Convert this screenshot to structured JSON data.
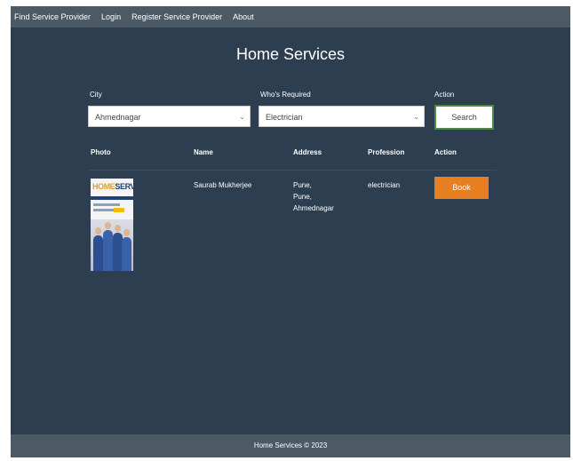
{
  "navbar": {
    "links": [
      "Find Service Provider",
      "Login",
      "Register Service Provider",
      "About"
    ]
  },
  "page": {
    "title": "Home Services"
  },
  "search": {
    "city_label": "City",
    "city_value": "Ahmednagar",
    "who_label": "Who's Required",
    "who_value": "Electrician",
    "action_label": "Action",
    "search_button": "Search"
  },
  "table": {
    "headers": [
      "Photo",
      "Name",
      "Address",
      "Profession",
      "Action"
    ],
    "rows": [
      {
        "photo_logo_left": "HOME",
        "photo_logo_right": "SERVICE",
        "name": "Saurab Mukherjee",
        "address_lines": [
          "Pune,",
          "Pune,",
          "Ahmednagar"
        ],
        "profession": "electrician",
        "action": "Book"
      }
    ]
  },
  "footer": {
    "text": "Home Services © 2023"
  }
}
